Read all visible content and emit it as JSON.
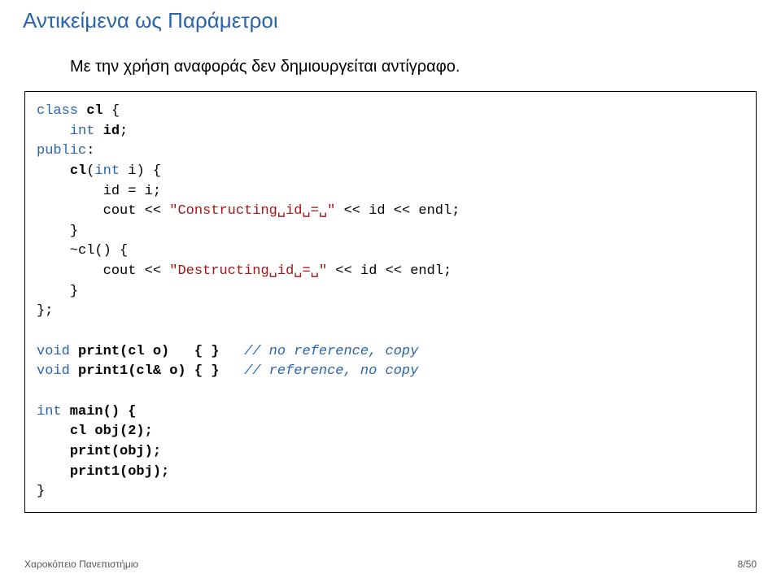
{
  "title": "Αντικείμενα ως Παράμετροι",
  "subtitle": "Με την χρήση αναφοράς δεν δημιουργείται αντίγραφο.",
  "code": {
    "kw_class": "class",
    "cl": "cl",
    "lb": " {",
    "indent1": "    ",
    "indent2": "        ",
    "kw_int": "int",
    "id_field": " id",
    "semi": ";",
    "kw_public": "public",
    "colon": ":",
    "ctor_sig": "(",
    "kw_int2": "int",
    "param_i": " i",
    "rp_lb": ") {",
    "assign": "id = i;",
    "cout": "cout << ",
    "str_con": "\"Constructing␣id␣=␣\"",
    "tail_con": " << id << endl;",
    "rb": "}",
    "dtor": "~cl() {",
    "str_des": "\"Destructing␣id␣=␣\"",
    "tail_des": " << id << endl;",
    "close_class": "};",
    "kw_void": "void",
    "print_sig": " print(cl o)   { }   ",
    "cm_noref": "// no reference, copy",
    "print1_sig": " print1(cl& o) { }   ",
    "cm_ref": "// reference, no copy",
    "main_sig": " main() {",
    "obj_decl": "cl obj(2);",
    "call_print": "print(obj);",
    "call_print1": "print1(obj);"
  },
  "footer_left": "Χαροκόπειο Πανεπιστήμιο",
  "footer_right": "8/50"
}
